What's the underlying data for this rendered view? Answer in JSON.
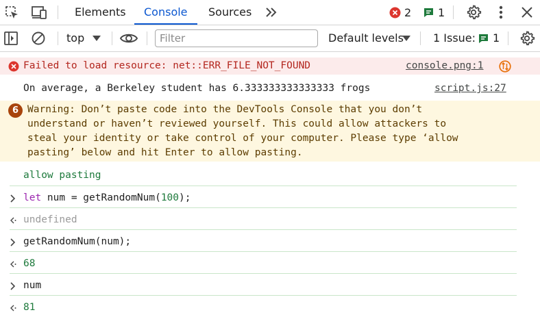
{
  "toolbar": {
    "tabs": [
      {
        "label": "Elements",
        "active": false
      },
      {
        "label": "Console",
        "active": true
      },
      {
        "label": "Sources",
        "active": false
      }
    ],
    "more_tabs_icon": "double-chevron-right-icon",
    "error_count": "2",
    "message_count": "1",
    "icons": [
      "inspect-element-icon",
      "device-toolbar-icon",
      "gear-icon",
      "kebab-menu-icon",
      "close-icon"
    ]
  },
  "console_toolbar": {
    "context": "top",
    "filter_placeholder": "Filter",
    "filter_value": "",
    "levels": "Default levels",
    "issues_label": "1 Issue:",
    "issues_count": "1"
  },
  "messages": {
    "error": {
      "text": "Failed to load resource: net::ERR_FILE_NOT_FOUND",
      "source": "console.png:1"
    },
    "log": {
      "text": "On average, a Berkeley student has 6.333333333333333 frogs",
      "source": "script.js:27"
    },
    "warning": {
      "badge": "6",
      "lines": [
        "Warning: Don’t paste code into the DevTools Console that you don’t",
        "understand or haven’t reviewed yourself. This could allow attackers to",
        "steal your identity or take control of your computer. Please type ‘allow",
        "pasting’ below and hit Enter to allow pasting."
      ]
    },
    "allow_pasting": "allow pasting",
    "entries": [
      {
        "kind": "input",
        "parts": [
          {
            "t": "let",
            "c": "kw"
          },
          {
            "t": " num = getRandomNum(",
            "c": ""
          },
          {
            "t": "100",
            "c": "num"
          },
          {
            "t": ");",
            "c": ""
          }
        ]
      },
      {
        "kind": "output",
        "text": "undefined",
        "style": "undef"
      },
      {
        "kind": "input",
        "parts": [
          {
            "t": "getRandomNum(num);",
            "c": ""
          }
        ]
      },
      {
        "kind": "output",
        "text": "68",
        "style": "green"
      },
      {
        "kind": "input",
        "parts": [
          {
            "t": "num",
            "c": ""
          }
        ]
      },
      {
        "kind": "output",
        "text": "81",
        "style": "green"
      }
    ]
  },
  "colors": {
    "accent": "#0b57d0",
    "error": "#dc362e",
    "warning_badge": "#a8440c",
    "log_output": "#1e7a3c"
  }
}
